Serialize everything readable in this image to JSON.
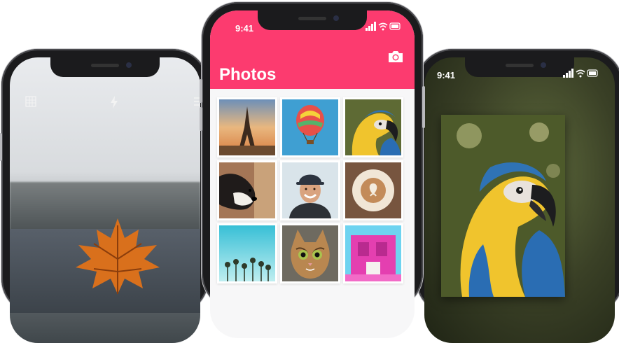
{
  "app": {
    "title": "Photos",
    "accent_color": "#fc3b6f"
  },
  "status_bar": {
    "time_center": "9:41",
    "time_right": "9:41"
  },
  "camera_screen": {
    "icons": [
      "grid-icon",
      "flash-icon",
      "switch-camera-icon"
    ]
  },
  "header": {
    "camera_button_icon": "camera-icon"
  },
  "grid": {
    "photos": [
      {
        "subject": "eiffel-tower"
      },
      {
        "subject": "hot-air-balloon"
      },
      {
        "subject": "parrot"
      },
      {
        "subject": "dog"
      },
      {
        "subject": "smiling-man"
      },
      {
        "subject": "latte-art"
      },
      {
        "subject": "palm-trees"
      },
      {
        "subject": "cat"
      },
      {
        "subject": "pink-building"
      }
    ]
  },
  "detail": {
    "photo_subject": "parrot"
  }
}
